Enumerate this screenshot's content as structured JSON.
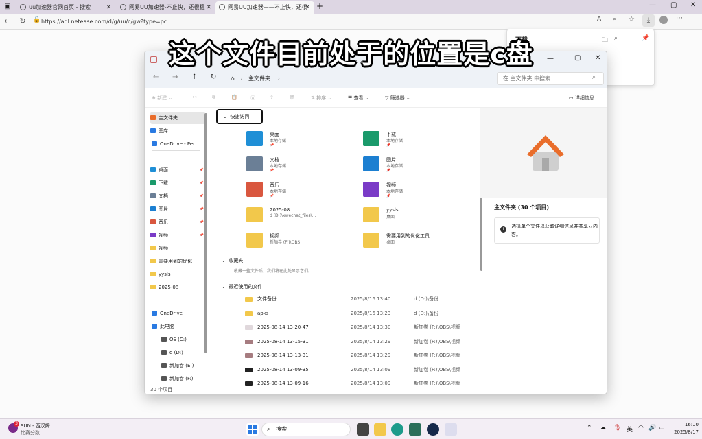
{
  "browser": {
    "tabs": [
      {
        "title": "uu加速器官网首页 - 搜索"
      },
      {
        "title": "网易UU加速器-不止快，还很稳"
      },
      {
        "title": "网易UU加速器——不止快，还很"
      }
    ],
    "url": "https://adl.netease.com/d/g/uu/c/gw?type=pc"
  },
  "caption": "这个文件目前处于的位置是c盘",
  "download_panel": {
    "title": "下载"
  },
  "explorer": {
    "tab_title": "主文件夹",
    "breadcrumb": "主文件夹",
    "search_placeholder": "在 主文件夹 中搜索",
    "commands": {
      "new": "新建",
      "sort": "排序",
      "view": "查看",
      "filter": "筛选器",
      "more": "…",
      "details": "详细信息"
    },
    "sidebar": [
      {
        "label": "主文件夹",
        "icon": "home-icon",
        "pinned": false
      },
      {
        "label": "图库",
        "icon": "gallery-icon",
        "pinned": false
      },
      {
        "label": "OneDrive - Per",
        "icon": "cloud-icon",
        "pinned": false
      },
      {
        "label": "桌面",
        "icon": "desktop-icon",
        "pinned": true
      },
      {
        "label": "下载",
        "icon": "download-icon",
        "pinned": true
      },
      {
        "label": "文档",
        "icon": "document-icon",
        "pinned": true
      },
      {
        "label": "图片",
        "icon": "picture-icon",
        "pinned": true
      },
      {
        "label": "音乐",
        "icon": "music-icon",
        "pinned": true
      },
      {
        "label": "视频",
        "icon": "video-icon",
        "pinned": true
      },
      {
        "label": "视频",
        "icon": "folder-icon",
        "pinned": false
      },
      {
        "label": "需要用到的优化",
        "icon": "folder-icon",
        "pinned": false
      },
      {
        "label": "yysls",
        "icon": "folder-icon",
        "pinned": false
      },
      {
        "label": "2025-08",
        "icon": "folder-icon",
        "pinned": false
      },
      {
        "label": "OneDrive",
        "icon": "cloud-icon",
        "pinned": false
      },
      {
        "label": "此电脑",
        "icon": "pc-icon",
        "pinned": false
      },
      {
        "label": "OS (C:)",
        "icon": "drive-icon",
        "pinned": false
      },
      {
        "label": "d (D:)",
        "icon": "drive-icon",
        "pinned": false
      },
      {
        "label": "新加卷 (E:)",
        "icon": "drive-icon",
        "pinned": false
      },
      {
        "label": "新加卷 (F:)",
        "icon": "drive-icon",
        "pinned": false
      }
    ],
    "quick_access_label": "快速访问",
    "quick_access": [
      {
        "name": "桌面",
        "sub": "本地存储",
        "pin": "📌",
        "color": "#1f8fd6"
      },
      {
        "name": "下载",
        "sub": "本地存储",
        "pin": "📌",
        "color": "#1a9a6b"
      },
      {
        "name": "文档",
        "sub": "本地存储",
        "pin": "📌",
        "color": "#6b7f96"
      },
      {
        "name": "图片",
        "sub": "本地存储",
        "pin": "📌",
        "color": "#1c7fd1"
      },
      {
        "name": "音乐",
        "sub": "本地存储",
        "pin": "📌",
        "color": "#d9573f"
      },
      {
        "name": "视频",
        "sub": "本地存储",
        "pin": "📌",
        "color": "#7a3bc7"
      },
      {
        "name": "2025-08",
        "sub": "d (D:)\\xwechat_files\\...",
        "pin": "",
        "color": "#f2c84b"
      },
      {
        "name": "yysls",
        "sub": "桌面",
        "pin": "",
        "color": "#f2c84b"
      },
      {
        "name": "视频",
        "sub": "新加卷 (F:)\\OBS",
        "pin": "",
        "color": "#f2c84b"
      },
      {
        "name": "需要用到的优化工具",
        "sub": "桌面",
        "pin": "",
        "color": "#f2c84b"
      }
    ],
    "favorites_label": "收藏夹",
    "favorites_empty": "收藏一些文件后，我们将在此处显示它们。",
    "recent_label": "最近使用的文件",
    "recent": [
      {
        "name": "文件备份",
        "date": "2025/8/16 13:40",
        "location": "d (D:)\\备份",
        "icon": "folder-icon",
        "color": "#f2c84b"
      },
      {
        "name": "apks",
        "date": "2025/8/16 13:23",
        "location": "d (D:)\\备份",
        "icon": "folder-icon",
        "color": "#f2c84b"
      },
      {
        "name": "2025-08-14 13-20-47",
        "date": "2025/8/14 13:30",
        "location": "新加卷 (F:)\\OBS\\视频",
        "icon": "video-file-icon",
        "color": "#e0d8dc"
      },
      {
        "name": "2025-08-14 13-15-31",
        "date": "2025/8/14 13:29",
        "location": "新加卷 (F:)\\OBS\\视频",
        "icon": "video-file-icon",
        "color": "#a67c80"
      },
      {
        "name": "2025-08-14 13-13-31",
        "date": "2025/8/14 13:29",
        "location": "新加卷 (F:)\\OBS\\视频",
        "icon": "video-file-icon",
        "color": "#a67c80"
      },
      {
        "name": "2025-08-14 13-09-35",
        "date": "2025/8/14 13:09",
        "location": "新加卷 (F:)\\OBS\\视频",
        "icon": "video-file-icon",
        "color": "#222222"
      },
      {
        "name": "2025-08-14 13-09-16",
        "date": "2025/8/14 13:09",
        "location": "新加卷 (F:)\\OBS\\视频",
        "icon": "video-file-icon",
        "color": "#222222"
      }
    ],
    "details": {
      "title": "主文件夹 (30 个项目)",
      "info": "选择单个文件以获取详细信息并共享云内容。"
    },
    "status": "30 个项目"
  },
  "taskbar": {
    "user_name": "SUN - 西汉姆",
    "user_sub": "比赛分数",
    "badge": "3",
    "search": "搜索",
    "ime": "英",
    "time": "16:10",
    "date": "2025/8/17"
  }
}
